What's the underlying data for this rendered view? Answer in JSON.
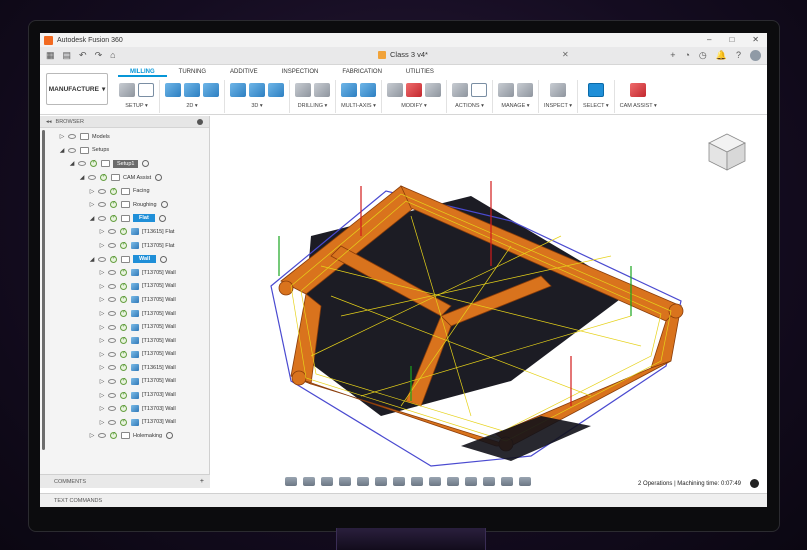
{
  "window": {
    "title": "Autodesk Fusion 360",
    "minimize": "–",
    "maximize": "□",
    "close": "✕"
  },
  "document_tab": {
    "label": "Class 3 v4*",
    "close": "✕"
  },
  "ribbon": {
    "workspace": "MANUFACTURE",
    "tabs": [
      "MILLING",
      "TURNING",
      "ADDITIVE",
      "INSPECTION",
      "FABRICATION",
      "UTILITIES"
    ],
    "groups": [
      "SETUP ▾",
      "2D ▾",
      "3D ▾",
      "DRILLING ▾",
      "MULTI-AXIS ▾",
      "MODIFY ▾",
      "ACTIONS ▾",
      "MANAGE ▾",
      "INSPECT ▾",
      "SELECT ▾",
      "CAM ASSIST ▾"
    ]
  },
  "browser": {
    "title": "BROWSER",
    "rows": [
      {
        "label": "Models"
      },
      {
        "label": "Setups"
      },
      {
        "label": "Setup1"
      },
      {
        "label": "CAM Assist"
      },
      {
        "label": "Facing"
      },
      {
        "label": "Roughing"
      },
      {
        "label": "Flat"
      },
      {
        "label": "[T13615] Flat"
      },
      {
        "label": "[T13705] Flat"
      },
      {
        "label": "Wall"
      },
      {
        "label": "[T13705] Wall"
      },
      {
        "label": "[T13705] Wall"
      },
      {
        "label": "[T13705] Wall"
      },
      {
        "label": "[T13705] Wall"
      },
      {
        "label": "[T13705] Wall"
      },
      {
        "label": "[T13705] Wall"
      },
      {
        "label": "[T13705] Wall"
      },
      {
        "label": "[T13615] Wall"
      },
      {
        "label": "[T13705] Wall"
      },
      {
        "label": "[T13703] Wall"
      },
      {
        "label": "[T13703] Wall"
      },
      {
        "label": "[T13703] Wall"
      },
      {
        "label": "Holemaking"
      }
    ]
  },
  "comments": {
    "label": "COMMENTS",
    "add": "+"
  },
  "text_commands": {
    "label": "TEXT COMMANDS"
  },
  "status": {
    "text": "2 Operations | Machining time: 0:07:49"
  },
  "viewcube": {
    "face": "FRONT"
  }
}
